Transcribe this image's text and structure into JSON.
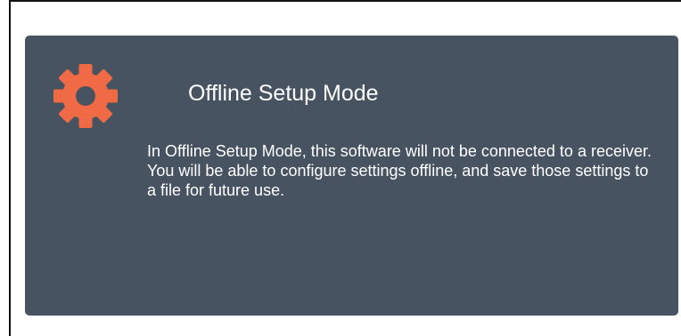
{
  "dialog": {
    "title": "Offline Setup Mode",
    "icon": "gear-icon",
    "accent_color": "#ef6a45",
    "background_color": "#475360",
    "paragraphs": [
      "In Offline Setup Mode, this software will not be connected to a receiver.",
      "You will be able to configure settings offline, and save those settings to a file for future use."
    ]
  }
}
